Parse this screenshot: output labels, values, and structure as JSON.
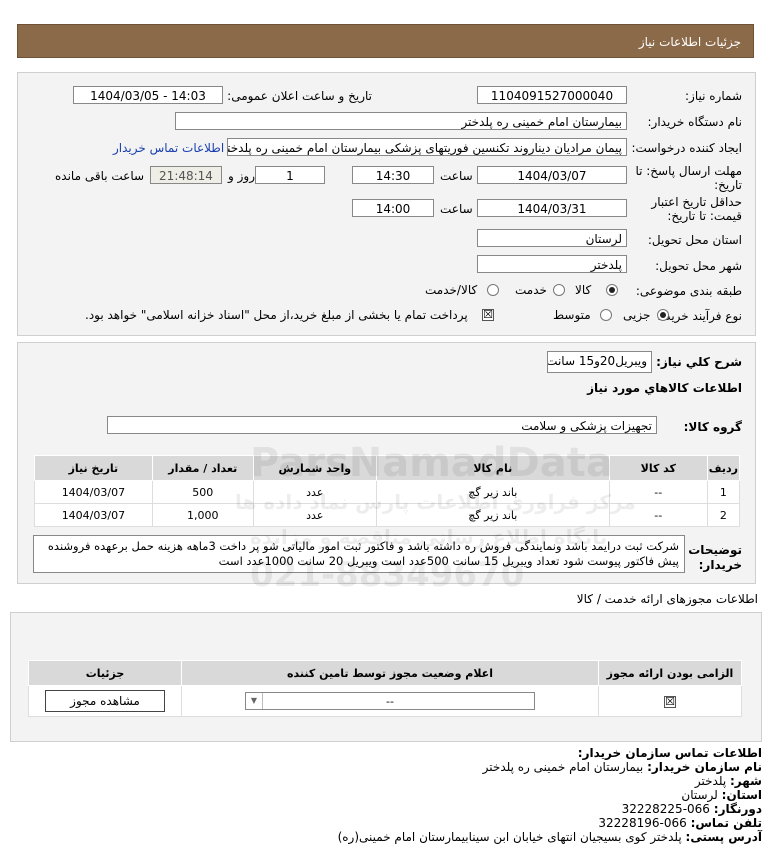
{
  "header": {
    "title": "جزئیات اطلاعات نیاز"
  },
  "need": {
    "number_label": "شماره نیاز:",
    "number": "1104091527000040",
    "announce_label": "تاریخ و ساعت اعلان عمومی:",
    "announce": "1404/03/05 - 14:03",
    "buyer_label": "نام دستگاه خریدار:",
    "buyer": "بیمارستان امام خمینی ره پلدختر",
    "creator_label": "ایجاد کننده درخواست:",
    "creator": "پیمان مرادیان دیناروند تکنسین فوریتهای پزشکی بیمارستان امام خمینی ره پلدختر",
    "contact_link": "اطلاعات تماس خریدار",
    "deadline_label_1": "مهلت ارسال پاسخ: تا",
    "deadline_label_2": "تاریخ:",
    "deadline_date": "1404/03/07",
    "time_label": "ساعت",
    "deadline_time": "14:30",
    "days": "1",
    "days_label": "روز و",
    "remaining": "21:48:14",
    "remaining_label": "ساعت باقی مانده",
    "validity_label_1": "حداقل تاریخ اعتبار",
    "validity_label_2": "قیمت: تا تاریخ:",
    "validity_date": "1404/03/31",
    "validity_time": "14:00",
    "province_label": "استان محل تحویل:",
    "province": "لرستان",
    "city_label": "شهر محل تحویل:",
    "city": "پلدختر",
    "category_label": "طبقه بندی موضوعی:",
    "cat_goods": "کالا",
    "cat_service": "خدمت",
    "cat_both": "کالا/خدمت",
    "process_label": "نوع فرآیند خرید :",
    "proc_minor": "جزیی",
    "proc_medium": "متوسط",
    "payment_note": "پرداخت تمام یا بخشی از مبلغ خرید،از محل \"اسناد خزانه اسلامی\" خواهد بود."
  },
  "summary": {
    "label": "شرح كلي نياز:",
    "value": "ویبریل20و15 سانت",
    "goods_title": "اطلاعات كالاهاي مورد نياز",
    "group_label": "گروه كالا:",
    "group_value": "تجهیزات پزشکی و سلامت"
  },
  "table": {
    "headers": [
      "ردیف",
      "کد کالا",
      "نام کالا",
      "واحد شمارش",
      "تعداد / مقدار",
      "تاریخ نیاز"
    ],
    "rows": [
      [
        "1",
        "--",
        "باند زیر گچ",
        "عدد",
        "500",
        "1404/03/07"
      ],
      [
        "2",
        "--",
        "باند زیر گچ",
        "عدد",
        "1,000",
        "1404/03/07"
      ]
    ]
  },
  "notes": {
    "label_1": "توضیحات",
    "label_2": "خریدار:",
    "text": "شرکت ثبت درایمد باشد ونمایندگی فروش ره داشته باشد و فاکتور ثبت امور مالیاتی شو پر داخت 3ماهه هزینه حمل برعهده فروشنده پیش فاکتور پیوست شود تعداد ویبریل 15 سانت 500عدد است ویبریل 20 سانت 1000عدد است"
  },
  "permits": {
    "title": "اطلاعات مجوزهای ارائه خدمت / کالا",
    "headers": [
      "الزامی بودن ارائه مجوز",
      "اعلام وضعیت مجوز توسط تامین کننده",
      "جزئیات"
    ],
    "select_value": "--",
    "view_button": "مشاهده مجوز"
  },
  "contact": {
    "title": "اطلاعات تماس سازمان خریدار:",
    "org_label": "نام سازمان خریدار:",
    "org": "بیمارستان امام خمینی ره پلدختر",
    "city_label": "شهر:",
    "city": "پلدختر",
    "province_label": "استان:",
    "province": "لرستان",
    "fax_label": "دورنگار:",
    "fax": "066-32228225",
    "phone_label": "تلفن تماس:",
    "phone": "066-32228196",
    "address_label": "آدرس پستی:",
    "address": "پلدختر کوی بسیجیان انتهای خیابان ابن سینابیمارستان امام خمینی(ره)"
  },
  "watermark": {
    "brand": "ParsNamadData",
    "brand_fa": "مرکز فراوری اطلاعات پارس نماد داده ها",
    "phone": "021-88349670",
    "sub": "پایگاه اطلاع رسانی مناقصه و مزایده"
  }
}
